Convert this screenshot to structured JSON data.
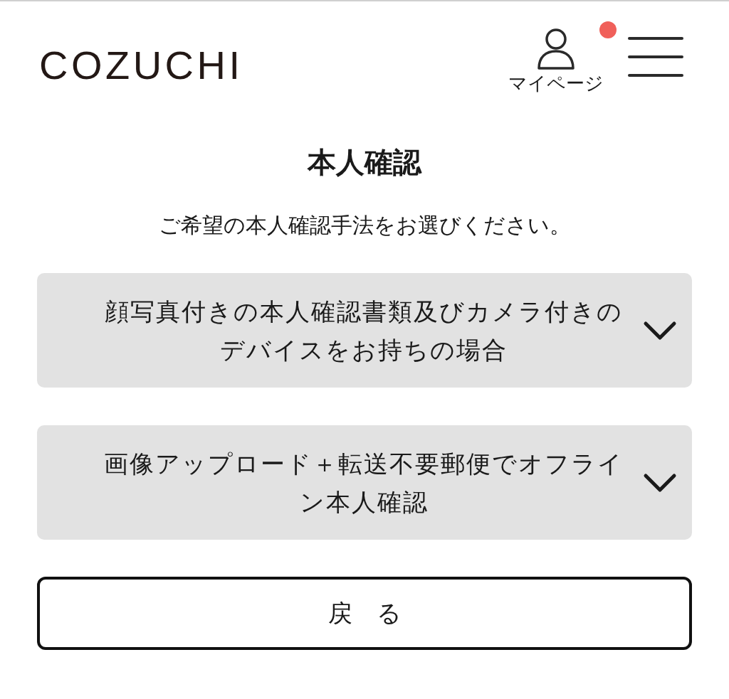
{
  "header": {
    "logo": "COZUCHI",
    "mypage": {
      "label": "マイページ",
      "notification": true
    }
  },
  "title": "本人確認",
  "subtitle": "ご希望の本人確認手法をお選びください。",
  "options": [
    {
      "label": "顔写真付きの本人確認書類及びカメラ付きのデバイスをお持ちの場合",
      "expanded": false
    },
    {
      "label": "画像アップロード＋転送不要郵便でオフライン本人確認",
      "expanded": false
    }
  ],
  "back_button": "戻　る"
}
